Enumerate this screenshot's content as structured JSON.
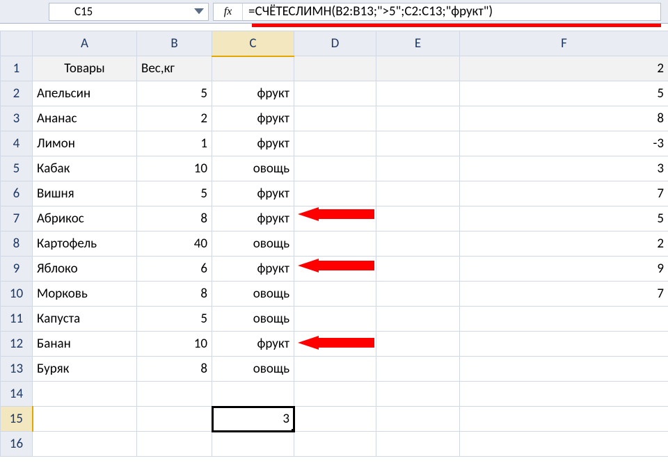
{
  "nameBox": {
    "value": "C15"
  },
  "formulaBar": {
    "fxLabel": "fx",
    "value": "=СЧЁТЕСЛИМН(B2:B13;\">5\";C2:C13;\"фрукт\")"
  },
  "columns": [
    "A",
    "B",
    "C",
    "D",
    "E",
    "F"
  ],
  "rowNumbers": [
    "1",
    "2",
    "3",
    "4",
    "5",
    "6",
    "7",
    "8",
    "9",
    "10",
    "11",
    "12",
    "13",
    "14",
    "15",
    "16"
  ],
  "selectedColumn": "C",
  "selectedRow": "15",
  "cells": {
    "r1": {
      "A": "Товары",
      "B": "Вес,кг",
      "C": "",
      "D": "",
      "E": "",
      "F": "2"
    },
    "r2": {
      "A": "Апельсин",
      "B": "5",
      "C": "фрукт",
      "D": "",
      "E": "",
      "F": "5"
    },
    "r3": {
      "A": "Ананас",
      "B": "2",
      "C": "фрукт",
      "D": "",
      "E": "",
      "F": "8"
    },
    "r4": {
      "A": "Лимон",
      "B": "1",
      "C": "фрукт",
      "D": "",
      "E": "",
      "F": "-3"
    },
    "r5": {
      "A": "Кабак",
      "B": "10",
      "C": "овощь",
      "D": "",
      "E": "",
      "F": "3"
    },
    "r6": {
      "A": "Вишня",
      "B": "5",
      "C": "фрукт",
      "D": "",
      "E": "",
      "F": "7"
    },
    "r7": {
      "A": "Абрикос",
      "B": "8",
      "C": "фрукт",
      "D": "",
      "E": "",
      "F": "5"
    },
    "r8": {
      "A": "Картофель",
      "B": "40",
      "C": "овощь",
      "D": "",
      "E": "",
      "F": "2"
    },
    "r9": {
      "A": "Яблоко",
      "B": "6",
      "C": "фрукт",
      "D": "",
      "E": "",
      "F": "9"
    },
    "r10": {
      "A": "Морковь",
      "B": "8",
      "C": "овощь",
      "D": "",
      "E": "",
      "F": "7"
    },
    "r11": {
      "A": "Капуста",
      "B": "5",
      "C": "овощь",
      "D": "",
      "E": "",
      "F": ""
    },
    "r12": {
      "A": "Банан",
      "B": "10",
      "C": "фрукт",
      "D": "",
      "E": "",
      "F": ""
    },
    "r13": {
      "A": "Буряк",
      "B": "8",
      "C": "овощь",
      "D": "",
      "E": "",
      "F": ""
    },
    "r14": {
      "A": "",
      "B": "",
      "C": "",
      "D": "",
      "E": "",
      "F": ""
    },
    "r15": {
      "A": "",
      "B": "",
      "C": "3",
      "D": "",
      "E": "",
      "F": ""
    },
    "r16": {
      "A": "",
      "B": "",
      "C": "",
      "D": "",
      "E": "",
      "F": ""
    }
  },
  "annotations": {
    "arrowRows": [
      7,
      9,
      12
    ],
    "arrowColor": "#ff0000"
  }
}
